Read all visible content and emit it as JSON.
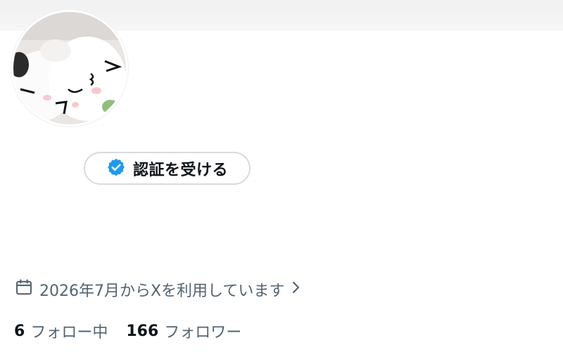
{
  "profile": {
    "avatar_alt": "profile-avatar"
  },
  "verify_button": {
    "label": "認証を受ける",
    "icon": "verified-badge-icon",
    "icon_color": "#1d9bf0"
  },
  "joined": {
    "icon": "calendar-icon",
    "text": "2026年7月からXを利用しています",
    "chevron": "chevron-right-icon"
  },
  "follow_stats": {
    "following_count": "6",
    "following_label": "フォロー中",
    "followers_count": "166",
    "followers_label": "フォロワー"
  },
  "colors": {
    "text_primary": "#0f1419",
    "text_secondary": "#536471",
    "border": "#d6dbdf"
  }
}
